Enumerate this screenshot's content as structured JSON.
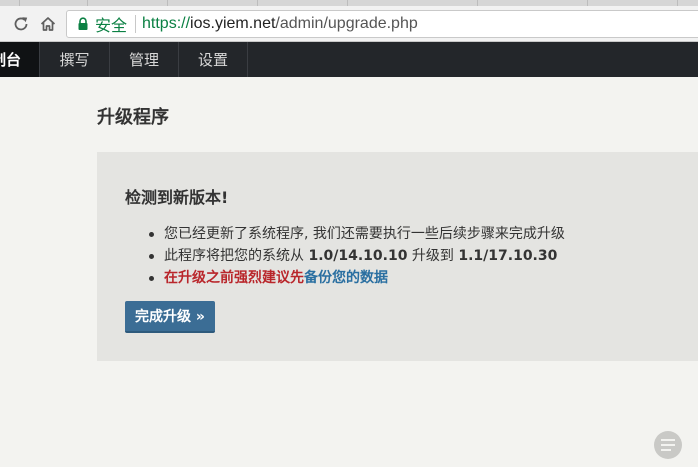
{
  "browser": {
    "secure_label": "安全",
    "url": {
      "scheme": "https://",
      "host": "ios.yiem.net",
      "path": "/admin/upgrade.php"
    }
  },
  "admin_nav": {
    "items": [
      {
        "label": "制台",
        "active": true
      },
      {
        "label": "撰写",
        "active": false
      },
      {
        "label": "管理",
        "active": false
      },
      {
        "label": "设置",
        "active": false
      }
    ]
  },
  "page": {
    "title": "升级程序",
    "panel": {
      "heading": "检测到新版本!",
      "step1": "您已经更新了系统程序, 我们还需要执行一些后续步骤来完成升级",
      "step2": {
        "prefix": "此程序将把您的系统从 ",
        "from_version": "1.0/14.10.10",
        "middle": " 升级到 ",
        "to_version": "1.1/17.10.30"
      },
      "step3": {
        "warning": "在升级之前强烈建议先",
        "link": "备份您的数据"
      },
      "button_label": "完成升级 »"
    }
  },
  "colors": {
    "admin_bar": "#23262a",
    "button": "#3b6d95",
    "warning": "#b9262b",
    "link": "#2a6fa1",
    "secure": "#0b8043"
  },
  "icons": [
    "reload-icon",
    "home-icon",
    "lock-icon",
    "menu-icon"
  ]
}
